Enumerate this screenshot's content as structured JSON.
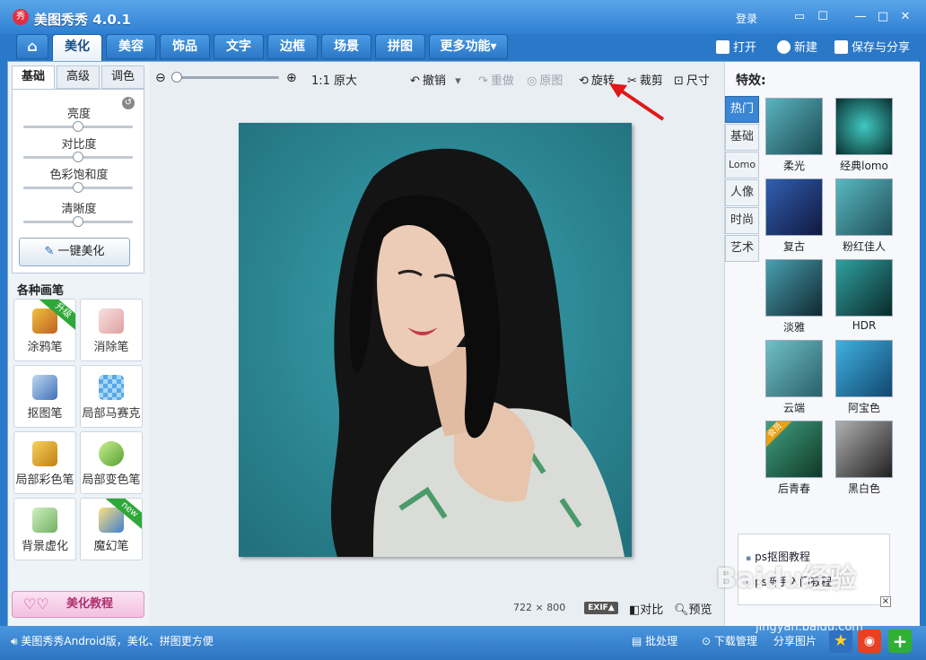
{
  "app": {
    "logo_char": "秀",
    "title": "美图秀秀 4.0.1",
    "login": "登录"
  },
  "tabs": [
    "美化",
    "美容",
    "饰品",
    "文字",
    "边框",
    "场景",
    "拼图",
    "更多功能▾"
  ],
  "topright": {
    "open": "打开",
    "new": "新建",
    "save_share": "保存与分享"
  },
  "left": {
    "subtabs": [
      "基础",
      "高级",
      "调色"
    ],
    "sliders": [
      {
        "label": "亮度",
        "value": 0.5
      },
      {
        "label": "对比度",
        "value": 0.5
      },
      {
        "label": "色彩饱和度",
        "value": 0.5
      },
      {
        "label": "清晰度",
        "value": 0.5
      }
    ],
    "onekey": "一键美化",
    "brush_title": "各种画笔",
    "brushes": [
      {
        "label": "涂鸦笔",
        "badge": "升级"
      },
      {
        "label": "消除笔",
        "badge": ""
      },
      {
        "label": "抠图笔",
        "badge": ""
      },
      {
        "label": "局部马赛克",
        "badge": ""
      },
      {
        "label": "局部彩色笔",
        "badge": ""
      },
      {
        "label": "局部变色笔",
        "badge": ""
      },
      {
        "label": "背景虚化",
        "badge": ""
      },
      {
        "label": "魔幻笔",
        "badge": "new"
      }
    ],
    "tutorial": "美化教程"
  },
  "toolbar": {
    "actual_size": "1:1 原大",
    "zoom_level": 0,
    "undo": "撤销",
    "redo": "重做",
    "original": "原图",
    "rotate": "旋转",
    "crop": "裁剪",
    "size": "尺寸"
  },
  "canvas": {
    "dims": "722 × 800",
    "exif": "EXIF▲",
    "compare": "对比",
    "preview": "预览"
  },
  "right": {
    "title": "特效:",
    "categories": [
      "热门",
      "基础",
      "Lomo",
      "人像",
      "时尚",
      "艺术"
    ],
    "effects": [
      {
        "label": "柔光"
      },
      {
        "label": "经典lomo"
      },
      {
        "label": "复古"
      },
      {
        "label": "粉红佳人"
      },
      {
        "label": "淡雅"
      },
      {
        "label": "HDR"
      },
      {
        "label": "云端"
      },
      {
        "label": "阿宝色"
      },
      {
        "label": "后青春",
        "tag": "会员"
      },
      {
        "label": "黑白色"
      }
    ],
    "ads": [
      "ps抠图教程",
      "ps新手入门教程"
    ],
    "ad_close": "×"
  },
  "status": {
    "message": "美图秀秀Android版，美化、拼图更方便",
    "batch": "批处理",
    "download": "下载管理",
    "share_img": "分享图片"
  },
  "watermark": {
    "logo": "Baidu经验",
    "url": "jingyan.baidu.com"
  },
  "colors": {
    "accent": "#2f80d2",
    "active_tab": "#ffffff",
    "photo_bg": "#2d8e9c",
    "arrow": "#e01818"
  }
}
